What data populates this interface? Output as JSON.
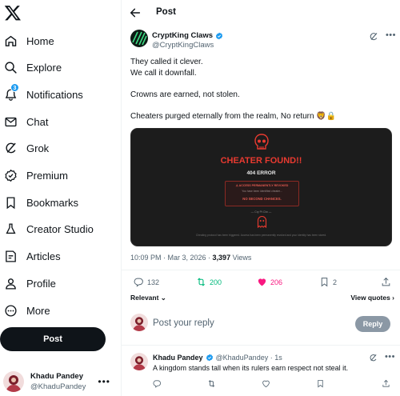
{
  "sidebar": {
    "logo_icon": "x-logo-icon",
    "items": [
      {
        "label": "Home",
        "icon": "home-icon"
      },
      {
        "label": "Explore",
        "icon": "search-icon"
      },
      {
        "label": "Notifications",
        "icon": "bell-icon",
        "badge": "3"
      },
      {
        "label": "Chat",
        "icon": "mail-icon"
      },
      {
        "label": "Grok",
        "icon": "grok-icon"
      },
      {
        "label": "Premium",
        "icon": "verified-icon"
      },
      {
        "label": "Bookmarks",
        "icon": "bookmark-icon"
      },
      {
        "label": "Creator Studio",
        "icon": "flask-icon"
      },
      {
        "label": "Articles",
        "icon": "article-icon"
      },
      {
        "label": "Profile",
        "icon": "person-icon"
      },
      {
        "label": "More",
        "icon": "more-circle-icon"
      }
    ],
    "post_button": "Post",
    "account": {
      "name": "Khadu Pandey",
      "handle": "@KhaduPandey"
    }
  },
  "header": {
    "title": "Post"
  },
  "tweet": {
    "author_name": "CryptKing Claws",
    "author_handle": "@CryptKingClaws",
    "paragraphs": [
      "They called it clever.\nWe call it downfall.",
      "Crowns are earned, not stolen.",
      "Cheaters purged eternally from the realm, No return 🦁🔒"
    ],
    "media": {
      "headline": "CHEATER FOUND!!",
      "code": "404 ERROR",
      "box_line1": "⚠ ACCESS PERMANENTLY REVOKED",
      "box_line2": "You have been identified cheater...",
      "box_line3": "NO SECOND CHANCES.",
      "tiny_text": "— Cry Pt Clw —",
      "footer": "Cheating protocol has been triggered. Access has been permanently revoked and your identity has been stored."
    },
    "time": "10:09 PM · Mar 3, 2026 · ",
    "views_count": "3,397",
    "views_label": " Views",
    "stats": {
      "replies": "132",
      "reposts": "200",
      "likes": "206",
      "bookmarks": "2"
    },
    "colors": {
      "repost": "#00ba7c",
      "like": "#f91880",
      "accent": "#1d9bf0"
    }
  },
  "replies_sort": "Relevant ⌄",
  "view_quotes": "View quotes ›",
  "reply_box": {
    "placeholder": "Post your reply",
    "button": "Reply"
  },
  "reply": {
    "name": "Khadu Pandey",
    "handle": "@KhaduPandey · 1s",
    "text": "A kingdom stands tall when its rulers earn respect not steal it."
  }
}
